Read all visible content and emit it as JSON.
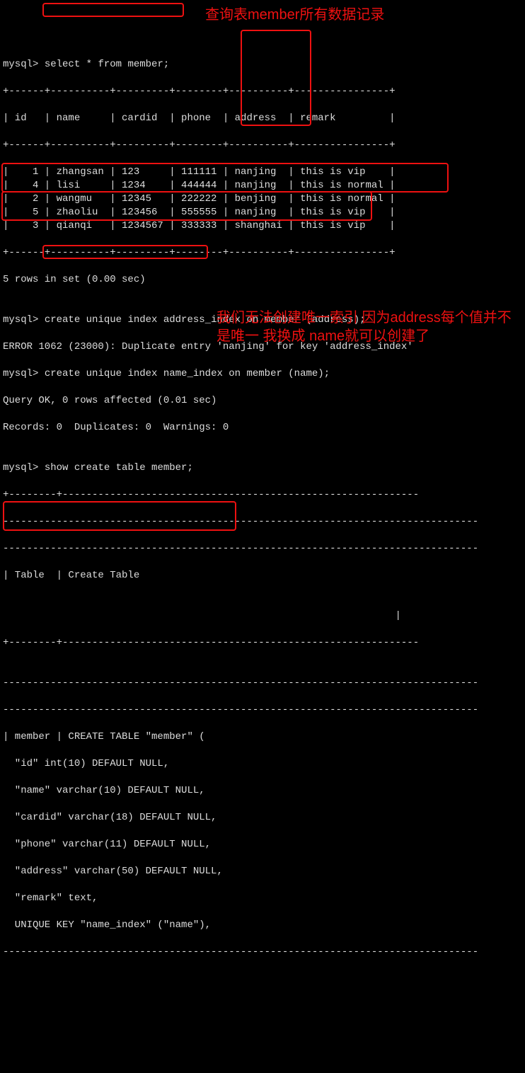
{
  "prompt": "mysql>",
  "cmd1": "select * from member;",
  "anno1": "查询表member所有数据记录",
  "anno2": "我们无法创建唯一索引 因为address每个值并不是唯一 我换成 name就可以创建了",
  "sep_top": "+------+----------+---------+--------+----------+----------------+",
  "hdr": "| id   | name     | cardid  | phone  | address  | remark         |",
  "rows": [
    {
      "id": "1",
      "name": "zhangsan",
      "cardid": "123",
      "phone": "111111",
      "address": "nanjing",
      "remark": "this is vip"
    },
    {
      "id": "4",
      "name": "lisi",
      "cardid": "1234",
      "phone": "444444",
      "address": "nanjing",
      "remark": "this is normal"
    },
    {
      "id": "2",
      "name": "wangmu",
      "cardid": "12345",
      "phone": "222222",
      "address": "benjing",
      "remark": "this is normal"
    },
    {
      "id": "5",
      "name": "zhaoliu",
      "cardid": "123456",
      "phone": "555555",
      "address": "nanjing",
      "remark": "this is vip"
    },
    {
      "id": "3",
      "name": "qianqi",
      "cardid": "1234567",
      "phone": "333333",
      "address": "shanghai",
      "remark": "this is vip"
    }
  ],
  "rowcount": "5 rows in set (0.00 sec)",
  "blank": "",
  "cmd2": "create unique index address_index on member (address);",
  "err2": "ERROR 1062 (23000): Duplicate entry 'nanjing' for key 'address_index'",
  "cmd3": "create unique index name_index on member (name);",
  "ok3": "Query OK, 0 rows affected (0.01 sec)",
  "rec3": "Records: 0  Duplicates: 0  Warnings: 0",
  "cmd4": "show create table member;",
  "sep2a": "+--------+------------------------------------------------------------",
  "sep2b": "--------------------------------------------------------------------------------",
  "sep2c": "--------------------------------------------------------------------------------",
  "sep2d": "| Table  | Create Table",
  "sep2e": "                                                                  |",
  "sep2f": "+--------+------------------------------------------------------------",
  "ct0": "| member | CREATE TABLE \"member\" (",
  "ct1": "  \"id\" int(10) DEFAULT NULL,",
  "ct2": "  \"name\" varchar(10) DEFAULT NULL,",
  "ct3": "  \"cardid\" varchar(18) DEFAULT NULL,",
  "ct4": "  \"phone\" varchar(11) DEFAULT NULL,",
  "ct5": "  \"address\" varchar(50) DEFAULT NULL,",
  "ct6": "  \"remark\" text,",
  "ct7": "  UNIQUE KEY \"name_index\" (\"name\"),"
}
